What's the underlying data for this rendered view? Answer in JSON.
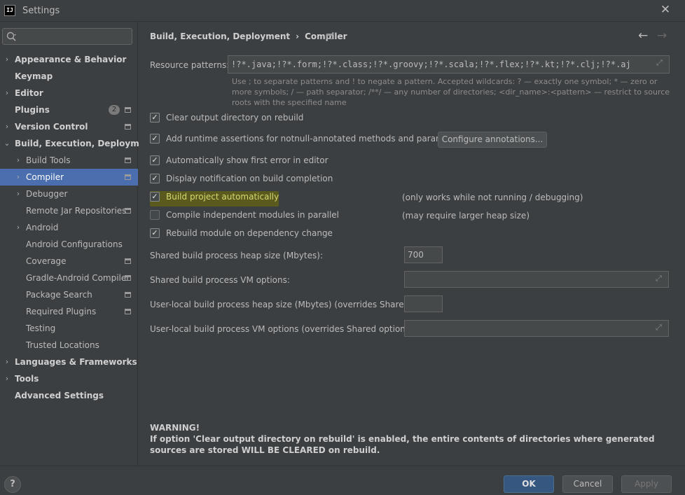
{
  "window": {
    "title": "Settings",
    "app_icon_text": "IJ"
  },
  "search": {
    "placeholder": ""
  },
  "sidebar": {
    "items": [
      {
        "label": "Appearance & Behavior",
        "bold": true,
        "expandable": true,
        "level": 0
      },
      {
        "label": "Keymap",
        "bold": true,
        "expandable": false,
        "level": 0
      },
      {
        "label": "Editor",
        "bold": true,
        "expandable": true,
        "level": 0
      },
      {
        "label": "Plugins",
        "bold": true,
        "expandable": false,
        "level": 0,
        "badge": "2",
        "project_icon": true
      },
      {
        "label": "Version Control",
        "bold": true,
        "expandable": true,
        "level": 0,
        "project_icon": true
      },
      {
        "label": "Build, Execution, Deployment",
        "bold": true,
        "expandable": true,
        "expanded": true,
        "level": 0
      },
      {
        "label": "Build Tools",
        "expandable": true,
        "level": 1,
        "project_icon": true
      },
      {
        "label": "Compiler",
        "expandable": true,
        "level": 1,
        "selected": true,
        "project_icon": true
      },
      {
        "label": "Debugger",
        "expandable": true,
        "level": 1
      },
      {
        "label": "Remote Jar Repositories",
        "expandable": false,
        "level": 1,
        "project_icon": true
      },
      {
        "label": "Android",
        "expandable": true,
        "level": 1
      },
      {
        "label": "Android Configurations",
        "expandable": false,
        "level": 1
      },
      {
        "label": "Coverage",
        "expandable": false,
        "level": 1,
        "project_icon": true
      },
      {
        "label": "Gradle-Android Compiler",
        "expandable": false,
        "level": 1,
        "project_icon": true
      },
      {
        "label": "Package Search",
        "expandable": false,
        "level": 1,
        "project_icon": true
      },
      {
        "label": "Required Plugins",
        "expandable": false,
        "level": 1,
        "project_icon": true
      },
      {
        "label": "Testing",
        "expandable": false,
        "level": 1
      },
      {
        "label": "Trusted Locations",
        "expandable": false,
        "level": 1
      },
      {
        "label": "Languages & Frameworks",
        "bold": true,
        "expandable": true,
        "level": 0
      },
      {
        "label": "Tools",
        "bold": true,
        "expandable": true,
        "level": 0
      },
      {
        "label": "Advanced Settings",
        "bold": true,
        "expandable": false,
        "level": 0
      }
    ]
  },
  "header": {
    "breadcrumb_parent": "Build, Execution, Deployment",
    "breadcrumb_separator": "›",
    "breadcrumb_current": "Compiler",
    "back_icon": "←",
    "forward_icon": "→"
  },
  "compiler": {
    "resource_patterns_label": "Resource patterns:",
    "resource_patterns_value": "!?*.java;!?*.form;!?*.class;!?*.groovy;!?*.scala;!?*.flex;!?*.kt;!?*.clj;!?*.aj",
    "hint_text": "Use ; to separate patterns and ! to negate a pattern. Accepted wildcards: ? — exactly one symbol; * — zero or more symbols; / — path separator; /**/ — any number of directories; <dir_name>:<pattern> — restrict to source roots with the specified name",
    "options": [
      {
        "label": "Clear output directory on rebuild",
        "checked": true
      },
      {
        "label": "Add runtime assertions for notnull-annotated methods and parameters",
        "checked": true
      },
      {
        "label": "Automatically show first error in editor",
        "checked": true
      },
      {
        "label": "Display notification on build completion",
        "checked": true
      },
      {
        "label": "Build project automatically",
        "checked": true,
        "highlighted": true
      },
      {
        "label": "Compile independent modules in parallel",
        "checked": false
      },
      {
        "label": "Rebuild module on dependency change",
        "checked": true
      }
    ],
    "configure_annotations_label": "Configure annotations...",
    "build_auto_note": "(only works while not running / debugging)",
    "parallel_note": "(may require larger heap size)",
    "shared_heap_label": "Shared build process heap size (Mbytes):",
    "shared_heap_value": "700",
    "shared_vm_label": "Shared build process VM options:",
    "shared_vm_value": "",
    "local_heap_label": "User-local build process heap size (Mbytes) (overrides Shared size):",
    "local_heap_value": "",
    "local_vm_label": "User-local build process VM options (overrides Shared options):",
    "local_vm_value": "",
    "warning_title": "WARNING!",
    "warning_text": "If option 'Clear output directory on rebuild' is enabled, the entire contents of directories where generated sources are stored WILL BE CLEARED on rebuild."
  },
  "footer": {
    "help_label": "?",
    "ok_label": "OK",
    "cancel_label": "Cancel",
    "apply_label": "Apply"
  },
  "colors": {
    "background": "#3c3f41",
    "selection": "#4b6eaf",
    "highlight": "#5a5a1f",
    "primary_button": "#365880"
  }
}
